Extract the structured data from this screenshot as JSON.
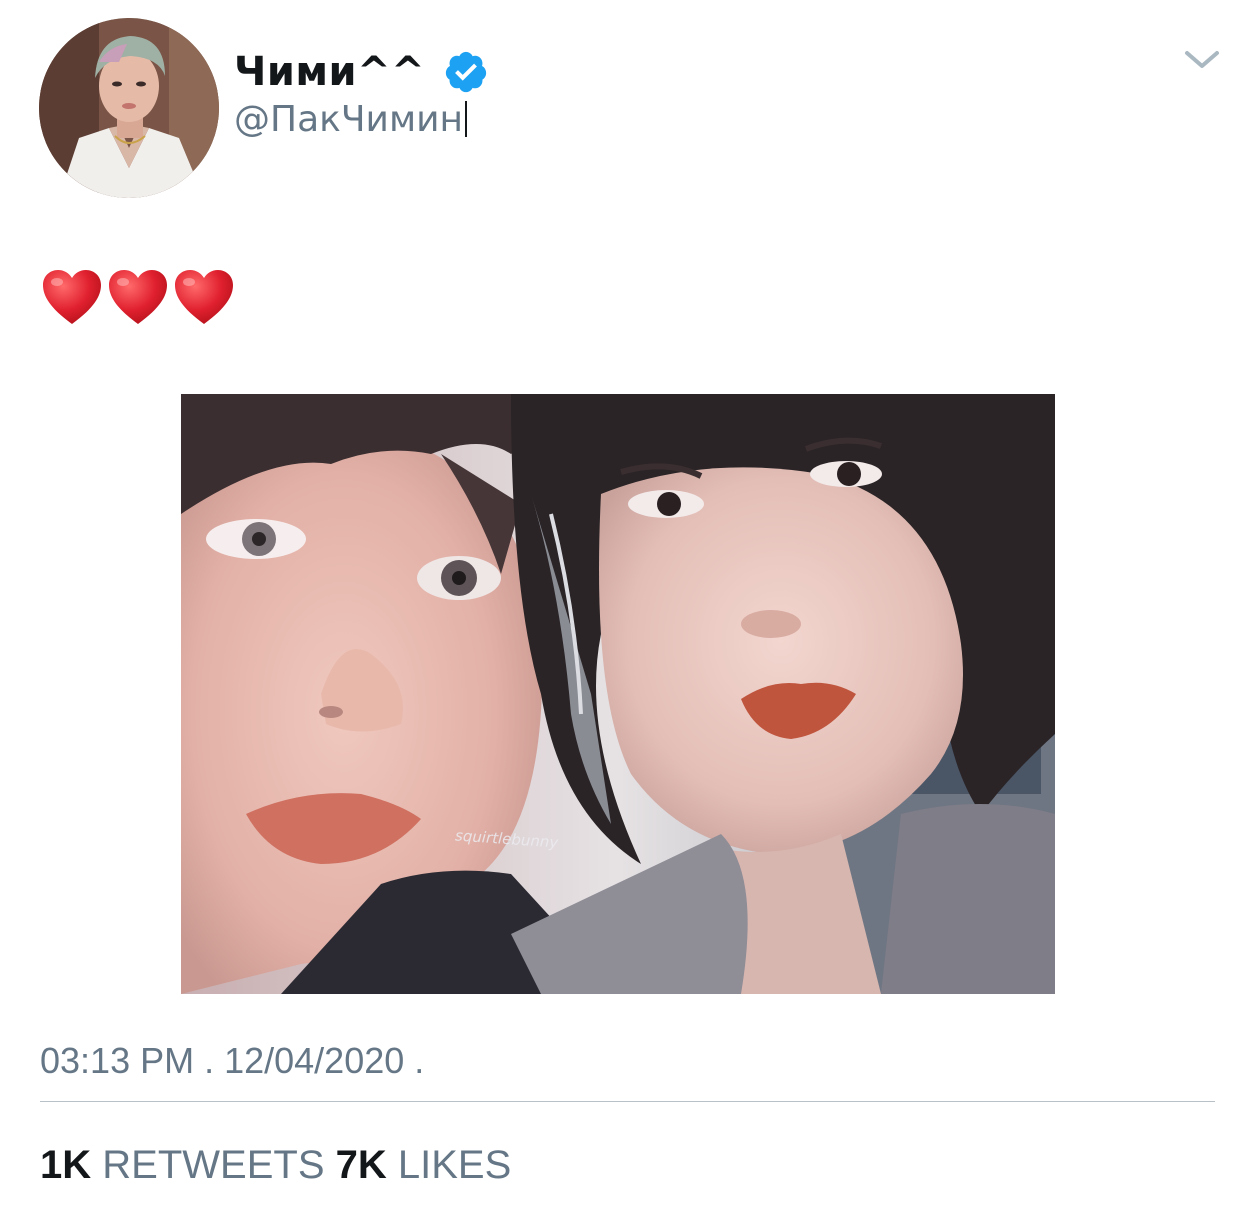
{
  "tweet": {
    "display_name": "Чими^^",
    "handle": "@ПакЧимин",
    "verified": true,
    "text_emojis": [
      "heart-icon",
      "heart-icon",
      "heart-icon"
    ],
    "media_watermark": "squirtlebunny",
    "timestamp": "03:13 PM . 12/04/2020 .",
    "stats": {
      "retweets_count": "1K",
      "retweets_label": "RETWEETS",
      "likes_count": "7K",
      "likes_label": "LIKES"
    }
  },
  "colors": {
    "text_primary": "#14171a",
    "text_secondary": "#657786",
    "verified_blue": "#1da1f2",
    "divider": "#b8c0c8",
    "heart_red": "#e0202e"
  }
}
